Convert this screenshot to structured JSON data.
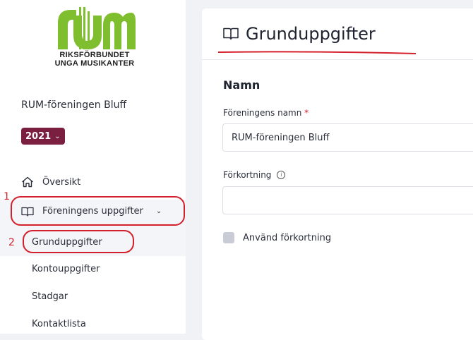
{
  "brand": {
    "line1": "RIKSFÖRBUNDET",
    "line2": "UNGA MUSIKANTER",
    "color": "#7fbf2f"
  },
  "sidebar": {
    "org_name": "RUM-föreningen Bluff",
    "year": "2021",
    "year_icon": "chevron-down-icon",
    "overview_label": "Översikt",
    "group_label": "Föreningens uppgifter",
    "sub_items": [
      "Grunduppgifter",
      "Kontouppgifter",
      "Stadgar",
      "Kontaktlista"
    ],
    "badge_color": "#7a1f3f"
  },
  "annotations": {
    "num1": "1",
    "num2": "2",
    "color": "#d4202c"
  },
  "main": {
    "title": "Grunduppgifter",
    "section_title": "Namn",
    "name_label": "Föreningens namn",
    "required_mark": "*",
    "name_value": "RUM-föreningen Bluff",
    "abbr_label": "Förkortning",
    "abbr_info_icon": "info-icon",
    "abbr_value": "",
    "use_abbr_label": "Använd förkortning",
    "use_abbr_checked": false
  }
}
